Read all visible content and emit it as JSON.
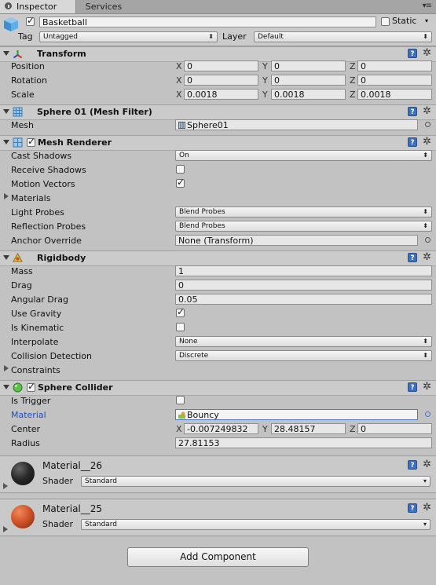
{
  "tabs": {
    "inspector": "Inspector",
    "services": "Services"
  },
  "gameobject": {
    "name": "Basketball",
    "static_label": "Static",
    "tag_label": "Tag",
    "tag_value": "Untagged",
    "layer_label": "Layer",
    "layer_value": "Default"
  },
  "transform": {
    "title": "Transform",
    "position_label": "Position",
    "rotation_label": "Rotation",
    "scale_label": "Scale",
    "axes": {
      "x": "X",
      "y": "Y",
      "z": "Z"
    },
    "position": {
      "x": "0",
      "y": "0",
      "z": "0"
    },
    "rotation": {
      "x": "0",
      "y": "0",
      "z": "0"
    },
    "scale": {
      "x": "0.0018",
      "y": "0.0018",
      "z": "0.0018"
    }
  },
  "mesh_filter": {
    "title": "Sphere 01 (Mesh Filter)",
    "mesh_label": "Mesh",
    "mesh_value": "Sphere01"
  },
  "mesh_renderer": {
    "title": "Mesh Renderer",
    "cast_shadows_label": "Cast Shadows",
    "cast_shadows_value": "On",
    "receive_shadows_label": "Receive Shadows",
    "receive_shadows": false,
    "motion_vectors_label": "Motion Vectors",
    "motion_vectors": true,
    "materials_label": "Materials",
    "light_probes_label": "Light Probes",
    "light_probes_value": "Blend Probes",
    "reflection_probes_label": "Reflection Probes",
    "reflection_probes_value": "Blend Probes",
    "anchor_override_label": "Anchor Override",
    "anchor_override_value": "None (Transform)"
  },
  "rigidbody": {
    "title": "Rigidbody",
    "mass_label": "Mass",
    "mass": "1",
    "drag_label": "Drag",
    "drag": "0",
    "angular_drag_label": "Angular Drag",
    "angular_drag": "0.05",
    "use_gravity_label": "Use Gravity",
    "use_gravity": true,
    "is_kinematic_label": "Is Kinematic",
    "is_kinematic": false,
    "interpolate_label": "Interpolate",
    "interpolate_value": "None",
    "collision_detection_label": "Collision Detection",
    "collision_detection_value": "Discrete",
    "constraints_label": "Constraints"
  },
  "sphere_collider": {
    "title": "Sphere Collider",
    "is_trigger_label": "Is Trigger",
    "is_trigger": false,
    "material_label": "Material",
    "material_value": "Bouncy",
    "center_label": "Center",
    "center": {
      "x": "-0.007249832",
      "y": "28.48157",
      "z": "0"
    },
    "radius_label": "Radius",
    "radius": "27.81153"
  },
  "materials": [
    {
      "name": "Material__26",
      "shader_label": "Shader",
      "shader": "Standard",
      "color": "#222222"
    },
    {
      "name": "Material__25",
      "shader_label": "Shader",
      "shader": "Standard",
      "color": "#d2552a"
    }
  ],
  "add_component_label": "Add Component",
  "colors": {
    "panel": "#c2c2c2",
    "header": "#cbcbcb",
    "focus_blue": "#4d78cc",
    "link_blue": "#1f4fc7"
  }
}
